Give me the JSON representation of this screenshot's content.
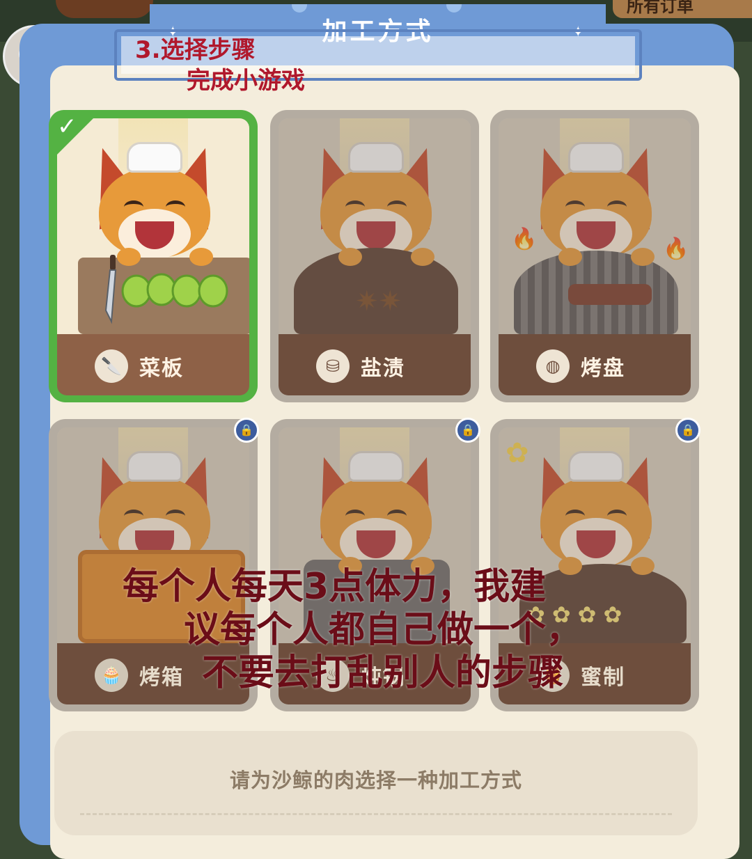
{
  "header": {
    "title": "加工方式",
    "orders_tab": "所有订单"
  },
  "annotations": {
    "step_note_line1": "3.选择步骤",
    "step_note_line2": "完成小游戏",
    "advice_line1": "每个人每天3点体力，我建",
    "advice_line2": "议每个人都自己做一个，",
    "advice_line3": "不要去打乱别人的步骤"
  },
  "methods": [
    {
      "label": "菜板",
      "icon": "cleaver-icon",
      "selected": true,
      "locked": false
    },
    {
      "label": "盐渍",
      "icon": "salt-shaker-icon",
      "selected": false,
      "locked": false
    },
    {
      "label": "烤盘",
      "icon": "grill-pan-icon",
      "selected": false,
      "locked": false
    },
    {
      "label": "烤箱",
      "icon": "muffin-icon",
      "selected": false,
      "locked": true
    },
    {
      "label": "炖锅",
      "icon": "pot-icon",
      "selected": false,
      "locked": true
    },
    {
      "label": "蜜制",
      "icon": "honey-icon",
      "selected": false,
      "locked": true
    }
  ],
  "prompt": "请为沙鲸的肉选择一种加工方式",
  "colors": {
    "panel_blue": "#6f9ad6",
    "selected_green": "#54b243",
    "annotation_red": "#b0182c",
    "card_base_brown": "#8e6147"
  }
}
